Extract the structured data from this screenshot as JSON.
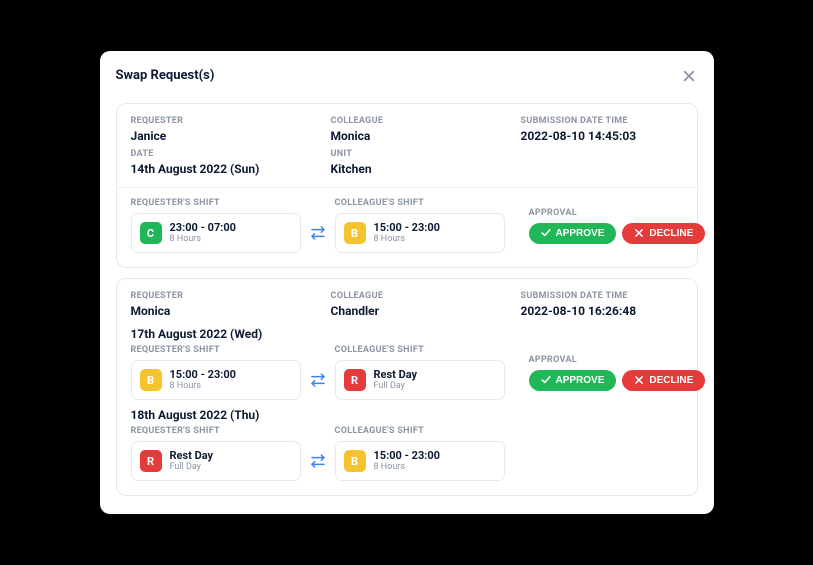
{
  "modal": {
    "title": "Swap Request(s)"
  },
  "labels": {
    "requester": "REQUESTER",
    "date": "DATE",
    "colleague": "COLLEAGUE",
    "unit": "UNIT",
    "submission": "SUBMISSION DATE TIME",
    "req_shift": "REQUESTER'S SHIFT",
    "col_shift": "COLLEAGUE'S SHIFT",
    "approval": "APPROVAL",
    "approve": "APPROVE",
    "decline": "DECLINE"
  },
  "colors": {
    "badge_C": "#1fb757",
    "badge_B": "#f4c430",
    "badge_R": "#e53b3b"
  },
  "requests": [
    {
      "requester": "Janice",
      "date": "14th August 2022 (Sun)",
      "colleague": "Monica",
      "unit": "Kitchen",
      "submitted": "2022-08-10 14:45:03",
      "swaps": [
        {
          "day": null,
          "req": {
            "code": "C",
            "time": "23:00 - 07:00",
            "dur": "8 Hours"
          },
          "col": {
            "code": "B",
            "time": "15:00 - 23:00",
            "dur": "8 Hours"
          }
        }
      ]
    },
    {
      "requester": "Monica",
      "date": null,
      "colleague": "Chandler",
      "unit": null,
      "submitted": "2022-08-10 16:26:48",
      "swaps": [
        {
          "day": "17th August 2022 (Wed)",
          "req": {
            "code": "B",
            "time": "15:00 - 23:00",
            "dur": "8 Hours"
          },
          "col": {
            "code": "R",
            "time": "Rest Day",
            "dur": "Full Day"
          }
        },
        {
          "day": "18th August 2022 (Thu)",
          "req": {
            "code": "R",
            "time": "Rest Day",
            "dur": "Full Day"
          },
          "col": {
            "code": "B",
            "time": "15:00 - 23:00",
            "dur": "8 Hours"
          }
        }
      ]
    }
  ]
}
